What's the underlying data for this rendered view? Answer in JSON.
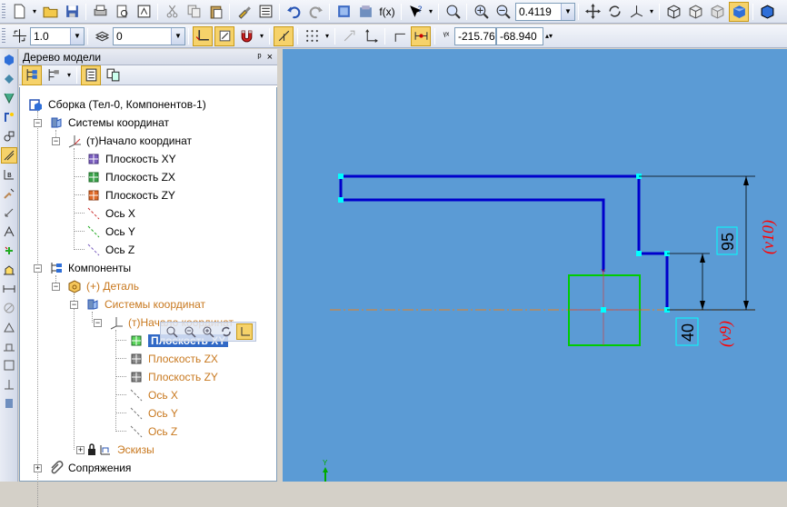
{
  "toolbar_top": {
    "zoom_value": "0.4119"
  },
  "toolbar_props": {
    "step_value": "1.0",
    "layer_value": "0",
    "coord_x": "-215.76",
    "coord_y": "-68.940"
  },
  "tree_panel": {
    "title": "Дерево модели",
    "pin_label": "ᵖ",
    "close_label": "×"
  },
  "tree": {
    "root": "Сборка (Тел-0, Компонентов-1)",
    "coord_systems": "Системы координат",
    "origin": "(т)Начало координат",
    "plane_xy": "Плоскость XY",
    "plane_zx": "Плоскость ZX",
    "plane_zy": "Плоскость ZY",
    "axis_x": "Ось X",
    "axis_y": "Ось Y",
    "axis_z": "Ось Z",
    "components": "Компоненты",
    "detail": "(+) Деталь",
    "detail_coord_systems": "Системы координат",
    "detail_origin": "(т)Начало координат",
    "detail_plane_xy": "Плоскость XY",
    "detail_plane_zx": "Плоскость ZX",
    "detail_plane_zy": "Плоскость ZY",
    "detail_axis_x": "Ось X",
    "detail_axis_y": "Ось Y",
    "detail_axis_z": "Ось Z",
    "sketches": "Эскизы",
    "mates": "Сопряжения"
  },
  "drawing": {
    "dim_95": "95",
    "dim_40": "40",
    "dim_v10": "(v10)",
    "dim_v9": "(v9)",
    "axis_label_y": "Y",
    "small_y": "Y"
  },
  "colors": {
    "canvas_bg": "#5b9bd5",
    "profile": "#0000cc",
    "selection_box": "#00cc00",
    "axis_line": "#e8821e",
    "dimension_red": "#ff0000"
  }
}
